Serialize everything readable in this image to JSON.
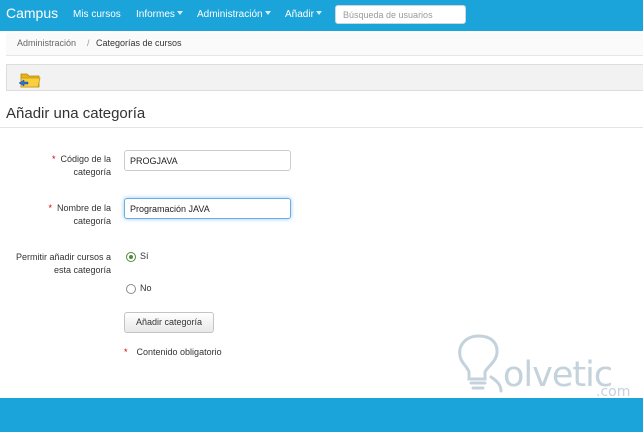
{
  "navbar": {
    "brand": "Campus",
    "items": [
      {
        "label": "Mis cursos",
        "dropdown": false
      },
      {
        "label": "Informes",
        "dropdown": true
      },
      {
        "label": "Administración",
        "dropdown": true
      },
      {
        "label": "Añadir",
        "dropdown": true
      }
    ],
    "search_placeholder": "Búsqueda de usuarios"
  },
  "breadcrumb": {
    "items": [
      "Administración",
      "Categorías de cursos"
    ],
    "separator": "/"
  },
  "toolbar": {
    "icons": [
      "folder-back-icon"
    ]
  },
  "form": {
    "title": "Añadir una categoría",
    "required_marker": "*",
    "fields": {
      "code": {
        "label_line1": "Código de la",
        "label_line2": "categoría",
        "value": "PROGJAVA"
      },
      "name": {
        "label_line1": "Nombre de la",
        "label_line2": "categoría",
        "value": "Programación JAVA"
      }
    },
    "allow_courses": {
      "label_line1": "Permitir añadir cursos a",
      "label_line2": "esta categoría",
      "options": [
        {
          "label": "Sí",
          "checked": true
        },
        {
          "label": "No",
          "checked": false
        }
      ]
    },
    "submit_label": "Añadir categoría",
    "required_note": "Contenido obligatorio"
  },
  "watermark": {
    "text": "olvetic",
    "suffix": ".com"
  },
  "colors": {
    "brand_blue": "#1aa4d9",
    "required_red": "#cc0000",
    "radio_green": "#4f8c3e",
    "focus_blue": "#66afe9"
  }
}
